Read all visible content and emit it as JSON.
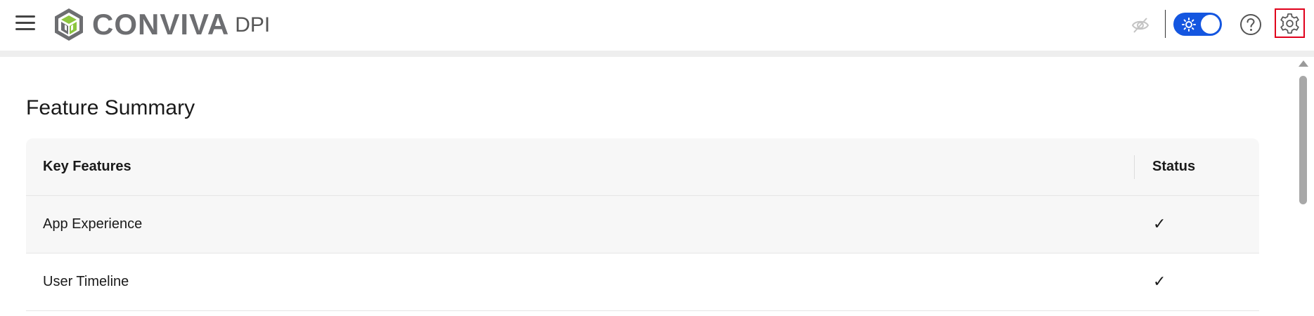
{
  "header": {
    "logo_word": "CONVIVA",
    "logo_suffix": "DPI",
    "icons": {
      "menu": "hamburger-menu-icon",
      "privacy": "eye-off-icon",
      "theme": "sun-icon",
      "help": "help-circle-icon",
      "settings": "gear-icon"
    },
    "theme_toggle_on": true,
    "colors": {
      "toggle": "#1456e0",
      "settings_highlight": "#e0001b",
      "logo_green": "#8dc63f",
      "logo_gray": "#6d6e71"
    }
  },
  "main": {
    "title": "Feature Summary",
    "table": {
      "columns": [
        "Key Features",
        "Status"
      ],
      "rows": [
        {
          "feature": "App Experience",
          "status": "✓"
        },
        {
          "feature": "User Timeline",
          "status": "✓"
        }
      ]
    }
  }
}
